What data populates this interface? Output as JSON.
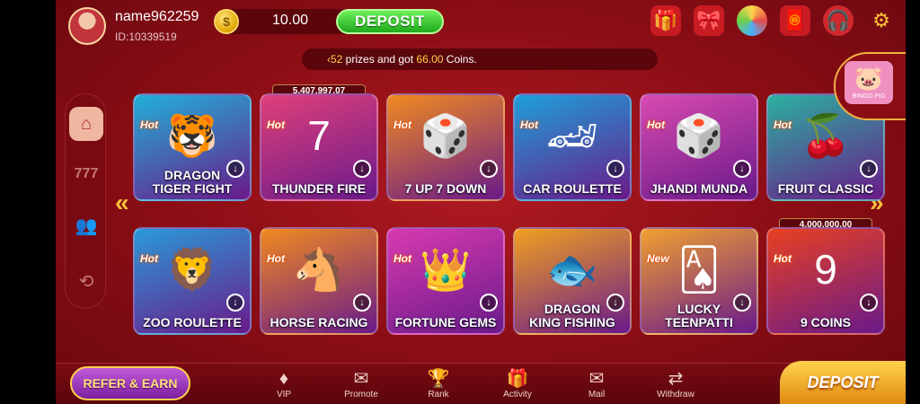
{
  "user": {
    "name": "name962259",
    "id_label": "ID:10339519"
  },
  "wallet": {
    "balance": "10.00",
    "deposit_label": "DEPOSIT",
    "coin_icon": "coin-icon"
  },
  "header_icons": [
    "gift-icon",
    "giftbox-icon",
    "spin-wheel-icon",
    "lucky-bag-icon",
    "support-icon",
    "gear-icon"
  ],
  "ticker": {
    "prefix": "‹52",
    "text": " prizes and got ",
    "amount": "66.00",
    "suffix": " Coins."
  },
  "sidebar": {
    "items": [
      "home-icon",
      "slots-777-icon",
      "users-icon",
      "history-icon"
    ]
  },
  "featured": {
    "label": "BINGO PIG"
  },
  "games_row1": [
    {
      "title_top": "DRAGON",
      "title": "TIGER  FIGHT",
      "hot": "Hot",
      "bg": "#22b0d8"
    },
    {
      "title_top": "",
      "title": "THUNDER FIRE",
      "hot": "Hot",
      "bg": "#e0407a",
      "jackpot": "5,407,997.07"
    },
    {
      "title_top": "",
      "title": "7 UP 7 DOWN",
      "hot": "Hot",
      "bg": "#f08a20"
    },
    {
      "title_top": "",
      "title": "CAR ROULETTE",
      "hot": "Hot",
      "bg": "#1ea0d8"
    },
    {
      "title_top": "",
      "title": "JHANDI MUNDA",
      "hot": "Hot",
      "bg": "#d84ab0"
    },
    {
      "title_top": "",
      "title": "FRUIT CLASSIC",
      "hot": "Hot",
      "bg": "#2bb0a0"
    }
  ],
  "games_row2": [
    {
      "title_top": "",
      "title": "ZOO ROULETTE",
      "hot": "Hot",
      "bg": "#2a9ad8"
    },
    {
      "title_top": "",
      "title": "HORSE RACING",
      "hot": "Hot",
      "bg": "#f08a20"
    },
    {
      "title_top": "",
      "title": "FORTUNE GEMS",
      "hot": "Hot",
      "bg": "#d83ab0"
    },
    {
      "title_top": "DRAGON",
      "title": "KING FISHING",
      "hot": "",
      "bg": "#f0a020"
    },
    {
      "title_top": "LUCKY",
      "title": "TEENPATTI",
      "hot": "New",
      "bg": "#f0a030"
    },
    {
      "title_top": "",
      "title": "9 COINS",
      "hot": "Hot",
      "bg": "#e84020",
      "jackpot": "4,000,000.00"
    }
  ],
  "bottom_nav": {
    "refer_label": "REFER & EARN",
    "items": [
      {
        "label": "VIP",
        "icon": "diamond-icon"
      },
      {
        "label": "Promote",
        "icon": "promote-icon"
      },
      {
        "label": "Rank",
        "icon": "trophy-icon"
      },
      {
        "label": "Activity",
        "icon": "activity-icon"
      },
      {
        "label": "Mail",
        "icon": "mail-icon"
      },
      {
        "label": "Withdraw",
        "icon": "withdraw-icon"
      }
    ],
    "deposit_label": "DEPOSIT"
  }
}
